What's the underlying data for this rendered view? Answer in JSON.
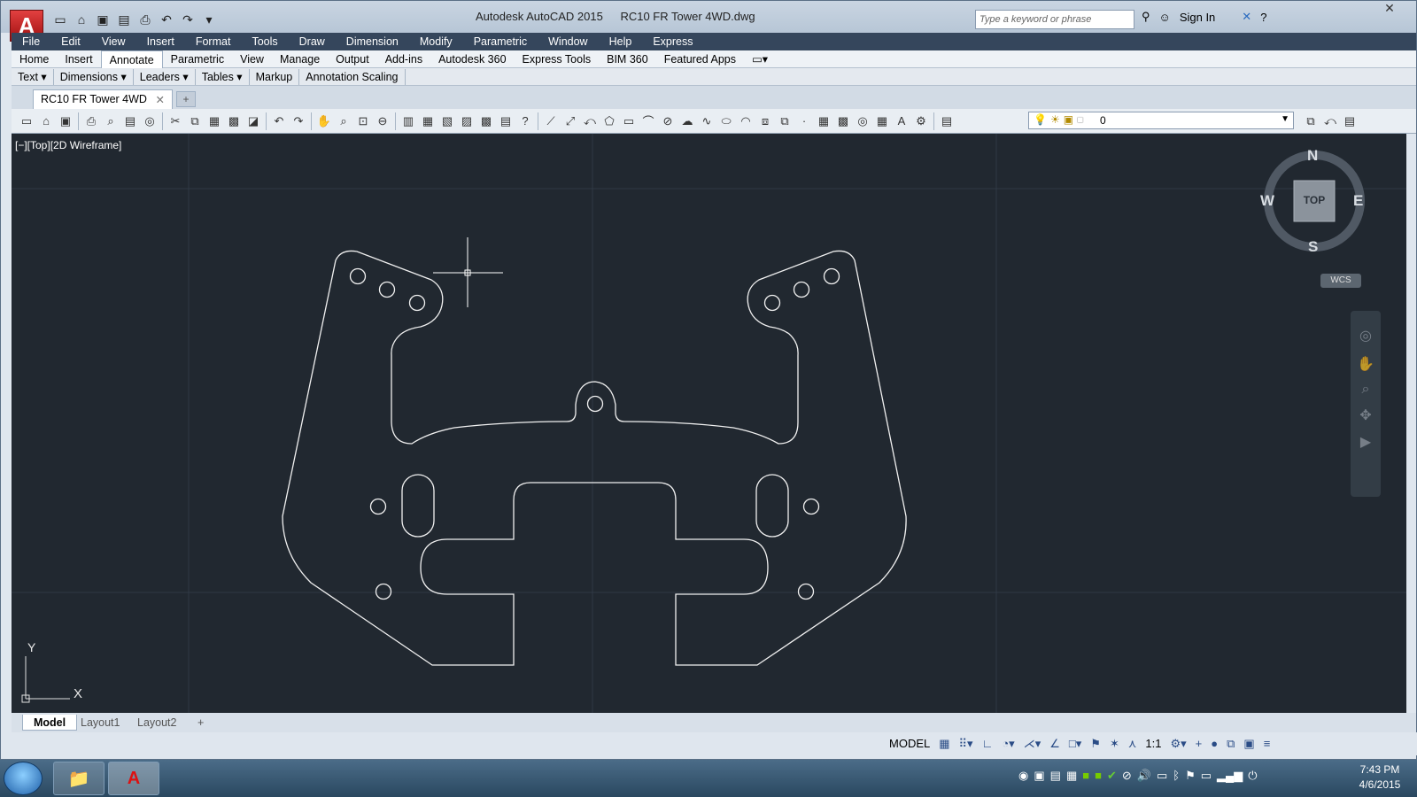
{
  "window": {
    "app_title": "Autodesk AutoCAD 2015",
    "file_title": "RC10 FR Tower 4WD.dwg",
    "search_placeholder": "Type a keyword or phrase",
    "sign_in": "Sign In"
  },
  "menu": [
    "File",
    "Edit",
    "View",
    "Insert",
    "Format",
    "Tools",
    "Draw",
    "Dimension",
    "Modify",
    "Parametric",
    "Window",
    "Help",
    "Express"
  ],
  "ribbon_tabs": [
    "Home",
    "Insert",
    "Annotate",
    "Parametric",
    "View",
    "Manage",
    "Output",
    "Add-ins",
    "Autodesk 360",
    "Express Tools",
    "BIM 360",
    "Featured Apps"
  ],
  "ribbon_active": "Annotate",
  "panels": [
    "Text",
    "Dimensions",
    "Leaders",
    "Tables",
    "Markup",
    "Annotation Scaling"
  ],
  "document_tab": "RC10 FR Tower 4WD",
  "layer": "0",
  "viewport_label": "[−][Top][2D Wireframe]",
  "viewcube": {
    "n": "N",
    "s": "S",
    "e": "E",
    "w": "W",
    "face": "TOP",
    "wcs": "WCS"
  },
  "ucs": {
    "x": "X",
    "y": "Y"
  },
  "layout_tabs": [
    "Model",
    "Layout1",
    "Layout2"
  ],
  "status": {
    "mode": "MODEL",
    "scale": "1:1"
  },
  "clock": {
    "time": "7:43 PM",
    "date": "4/6/2015"
  }
}
